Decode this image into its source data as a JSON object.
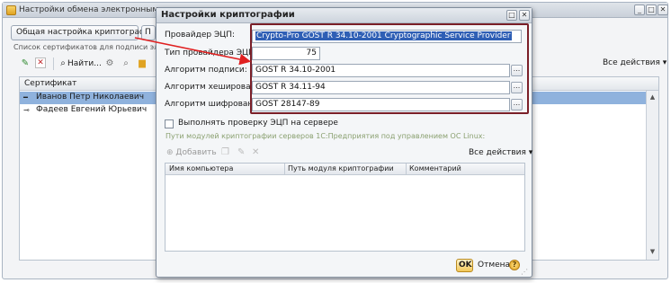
{
  "background_window": {
    "title": "Настройки обмена электронными",
    "general_crypto_button": "Общая настройка криптографии",
    "second_button": "П",
    "certificates_group_label": "Список сертификатов для подписи элек",
    "find_label": "Найти...",
    "all_actions": "Все действия",
    "table": {
      "column_certificate": "Сертификат",
      "rows": [
        {
          "name": "Иванов Петр Николаевич",
          "selected": true
        },
        {
          "name": "Фадеев Евгений Юрьевич",
          "selected": false
        }
      ]
    }
  },
  "dialog": {
    "title": "Настройки криптографии",
    "fields": {
      "provider_label": "Провайдер ЭЦП:",
      "provider_value": "Crypto-Pro GOST R 34.10-2001 Cryptographic Service Provider",
      "provider_type_label": "Тип провайдера ЭЦП:",
      "provider_type_value": "75",
      "sign_algorithm_label": "Алгоритм подписи:",
      "sign_algorithm_value": "GOST R 34.10-2001",
      "hash_algorithm_label": "Алгоритм хеширования:",
      "hash_algorithm_value": "GOST R 34.11-94",
      "encrypt_algorithm_label": "Алгоритм шифрования:",
      "encrypt_algorithm_value": "GOST 28147-89"
    },
    "verify_on_server_label": "Выполнять проверку ЭЦП на сервере",
    "verify_on_server_checked": false,
    "server_paths_title": "Пути модулей криптографии серверов 1С:Предприятия под управлением ОС Linux:",
    "toolbar": {
      "add_label": "Добавить",
      "all_actions": "Все действия"
    },
    "paths_table": {
      "columns": [
        "Имя компьютера",
        "Путь модуля криптографии",
        "Комментарий"
      ]
    },
    "ok_label": "OK",
    "cancel_label": "Отмена",
    "help_glyph": "?"
  },
  "colors": {
    "highlight_frame": "#7a1f28",
    "annotation_arrow": "#e02020",
    "selection": "#2f5fb5",
    "row_selected": "#8fb2dd"
  },
  "icons": {
    "window": [
      "app-icon",
      "minimize-icon",
      "maximize-icon",
      "close-icon"
    ],
    "toolbar": [
      "edit-pencil-icon",
      "delete-x-icon",
      "find-icon",
      "settings-icon",
      "search-icon",
      "folder-icon",
      "key-icon"
    ],
    "dialog_toolbar": [
      "add-icon",
      "copy-icon",
      "edit-icon",
      "delete-icon"
    ]
  }
}
